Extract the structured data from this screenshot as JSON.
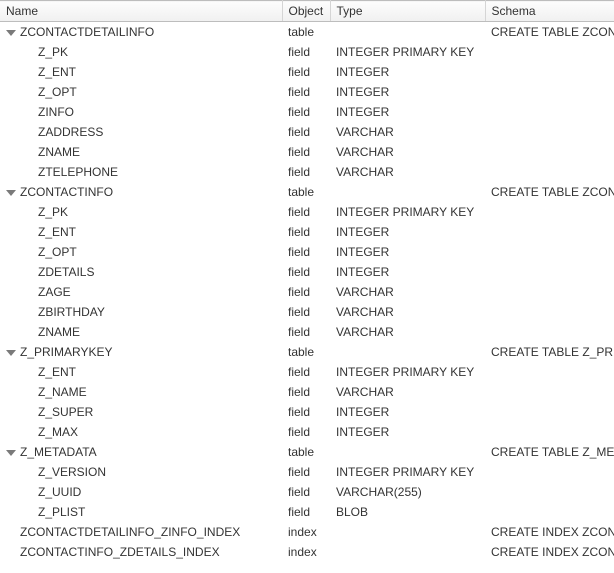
{
  "columns": {
    "name": "Name",
    "object": "Object",
    "type": "Type",
    "schema": "Schema"
  },
  "rows": [
    {
      "name": "ZCONTACTDETAILINFO",
      "object": "table",
      "type": "",
      "schema": "CREATE TABLE ZCONTAC",
      "level": 0,
      "hasChildren": true,
      "expanded": true
    },
    {
      "name": "Z_PK",
      "object": "field",
      "type": "INTEGER PRIMARY KEY",
      "schema": "",
      "level": 1
    },
    {
      "name": "Z_ENT",
      "object": "field",
      "type": "INTEGER",
      "schema": "",
      "level": 1
    },
    {
      "name": "Z_OPT",
      "object": "field",
      "type": "INTEGER",
      "schema": "",
      "level": 1
    },
    {
      "name": "ZINFO",
      "object": "field",
      "type": "INTEGER",
      "schema": "",
      "level": 1
    },
    {
      "name": "ZADDRESS",
      "object": "field",
      "type": "VARCHAR",
      "schema": "",
      "level": 1
    },
    {
      "name": "ZNAME",
      "object": "field",
      "type": "VARCHAR",
      "schema": "",
      "level": 1
    },
    {
      "name": "ZTELEPHONE",
      "object": "field",
      "type": "VARCHAR",
      "schema": "",
      "level": 1
    },
    {
      "name": "ZCONTACTINFO",
      "object": "table",
      "type": "",
      "schema": "CREATE TABLE ZCONTAC",
      "level": 0,
      "hasChildren": true,
      "expanded": true
    },
    {
      "name": "Z_PK",
      "object": "field",
      "type": "INTEGER PRIMARY KEY",
      "schema": "",
      "level": 1
    },
    {
      "name": "Z_ENT",
      "object": "field",
      "type": "INTEGER",
      "schema": "",
      "level": 1
    },
    {
      "name": "Z_OPT",
      "object": "field",
      "type": "INTEGER",
      "schema": "",
      "level": 1
    },
    {
      "name": "ZDETAILS",
      "object": "field",
      "type": "INTEGER",
      "schema": "",
      "level": 1
    },
    {
      "name": "ZAGE",
      "object": "field",
      "type": "VARCHAR",
      "schema": "",
      "level": 1
    },
    {
      "name": "ZBIRTHDAY",
      "object": "field",
      "type": "VARCHAR",
      "schema": "",
      "level": 1
    },
    {
      "name": "ZNAME",
      "object": "field",
      "type": "VARCHAR",
      "schema": "",
      "level": 1
    },
    {
      "name": "Z_PRIMARYKEY",
      "object": "table",
      "type": "",
      "schema": "CREATE TABLE Z_PRIMAR",
      "level": 0,
      "hasChildren": true,
      "expanded": true
    },
    {
      "name": "Z_ENT",
      "object": "field",
      "type": "INTEGER PRIMARY KEY",
      "schema": "",
      "level": 1
    },
    {
      "name": "Z_NAME",
      "object": "field",
      "type": "VARCHAR",
      "schema": "",
      "level": 1
    },
    {
      "name": "Z_SUPER",
      "object": "field",
      "type": "INTEGER",
      "schema": "",
      "level": 1
    },
    {
      "name": "Z_MAX",
      "object": "field",
      "type": "INTEGER",
      "schema": "",
      "level": 1
    },
    {
      "name": "Z_METADATA",
      "object": "table",
      "type": "",
      "schema": "CREATE TABLE Z_METAD",
      "level": 0,
      "hasChildren": true,
      "expanded": true
    },
    {
      "name": "Z_VERSION",
      "object": "field",
      "type": "INTEGER PRIMARY KEY",
      "schema": "",
      "level": 1
    },
    {
      "name": "Z_UUID",
      "object": "field",
      "type": "VARCHAR(255)",
      "schema": "",
      "level": 1
    },
    {
      "name": "Z_PLIST",
      "object": "field",
      "type": "BLOB",
      "schema": "",
      "level": 1
    },
    {
      "name": "ZCONTACTDETAILINFO_ZINFO_INDEX",
      "object": "index",
      "type": "",
      "schema": "CREATE INDEX ZCONTAC",
      "level": 0,
      "hasChildren": false
    },
    {
      "name": "ZCONTACTINFO_ZDETAILS_INDEX",
      "object": "index",
      "type": "",
      "schema": "CREATE INDEX ZCONTAC",
      "level": 0,
      "hasChildren": false
    }
  ]
}
